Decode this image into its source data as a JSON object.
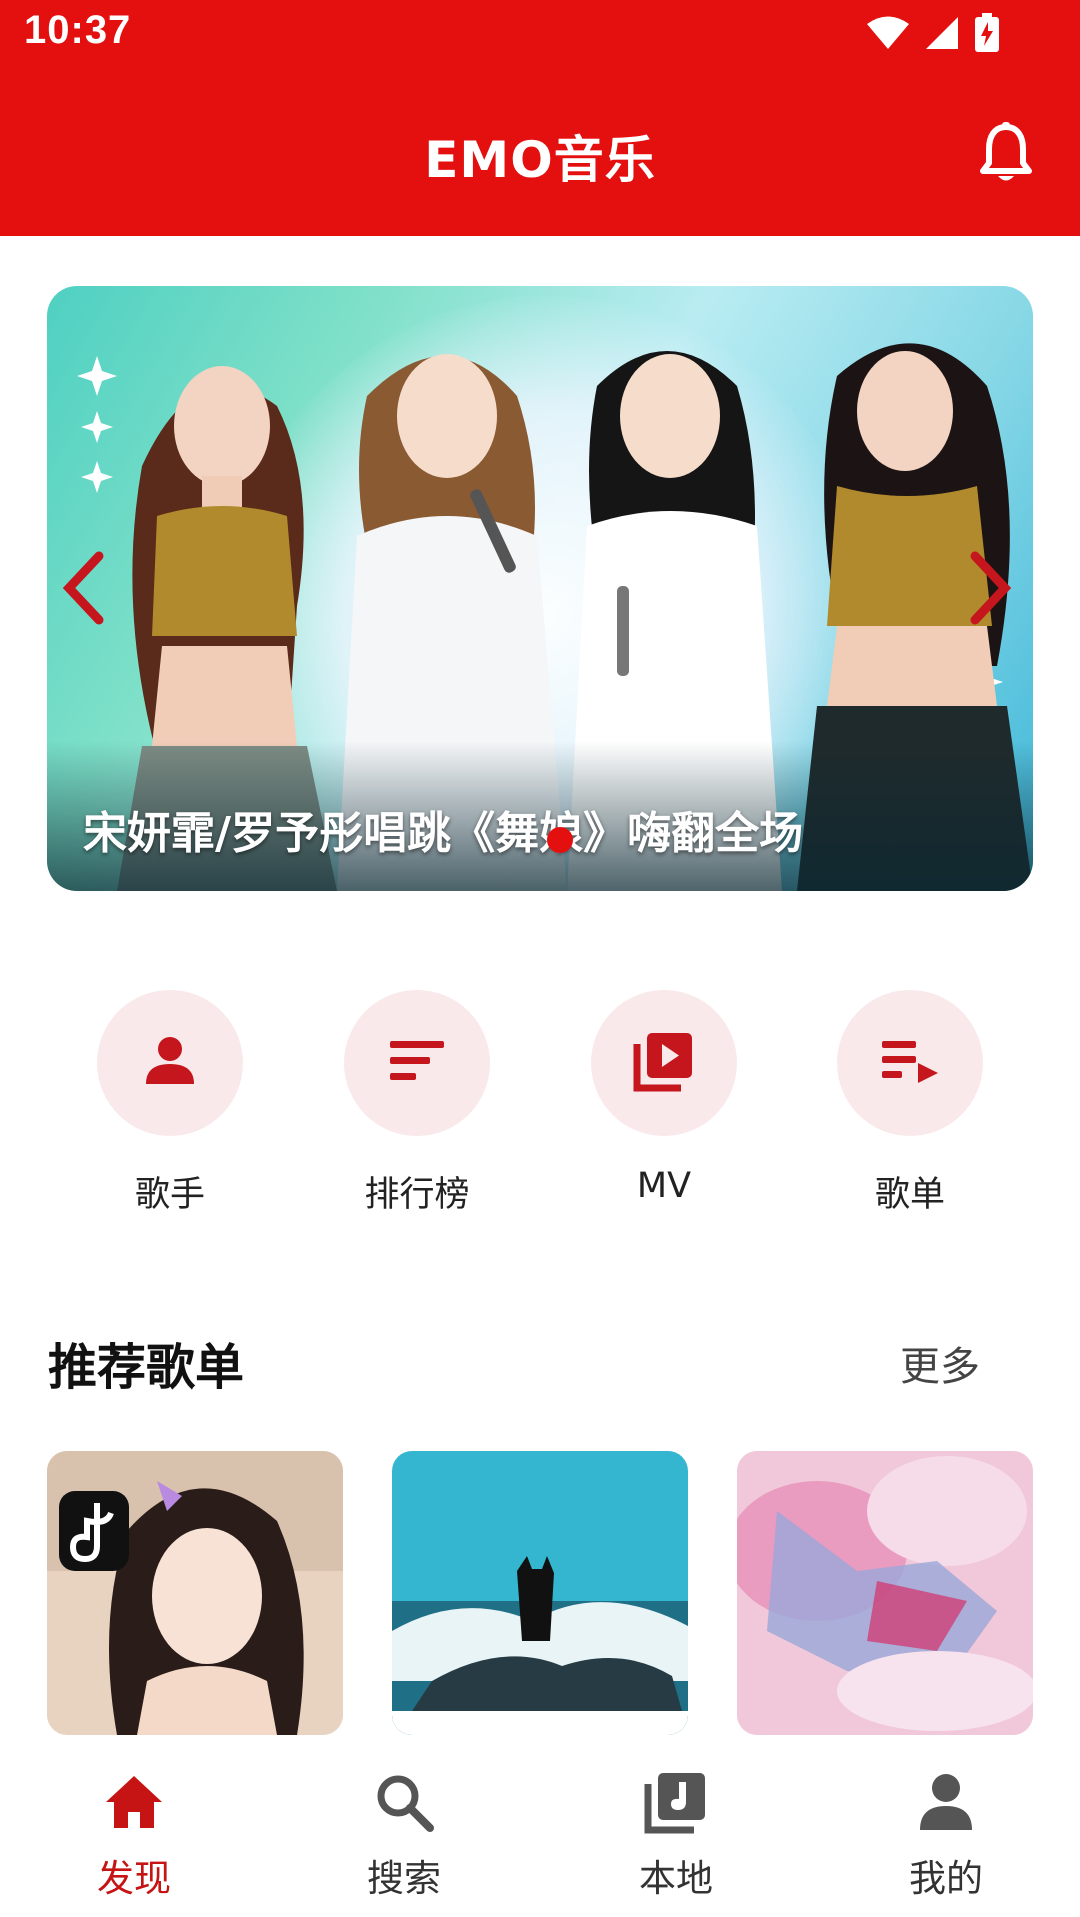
{
  "status_bar": {
    "time": "10:37",
    "icons": [
      "wifi-icon",
      "signal-icon",
      "battery-charging-icon"
    ]
  },
  "header": {
    "title": "EMO音乐",
    "right_icon": "bell-icon"
  },
  "banner": {
    "caption": "宋妍霏/罗予彤唱跳《舞娘》嗨翻全场",
    "left_arrow_icon": "chevron-left-icon",
    "right_arrow_icon": "chevron-right-icon"
  },
  "categories": [
    {
      "label": "歌手",
      "icon": "person-icon"
    },
    {
      "label": "排行榜",
      "icon": "ranking-icon"
    },
    {
      "label": "MV",
      "icon": "video-library-icon"
    },
    {
      "label": "歌单",
      "icon": "playlist-play-icon"
    }
  ],
  "recommended": {
    "title": "推荐歌单",
    "more_label": "更多"
  },
  "bottom_nav": {
    "items": [
      {
        "label": "发现",
        "icon": "home-icon",
        "active": true
      },
      {
        "label": "搜索",
        "icon": "search-icon",
        "active": false
      },
      {
        "label": "本地",
        "icon": "music-library-icon",
        "active": false
      },
      {
        "label": "我的",
        "icon": "person-icon",
        "active": false
      }
    ]
  },
  "colors": {
    "brand_red": "#e40f0f",
    "accent_dark_red": "#c61414",
    "category_bg": "#f9e9ea"
  }
}
